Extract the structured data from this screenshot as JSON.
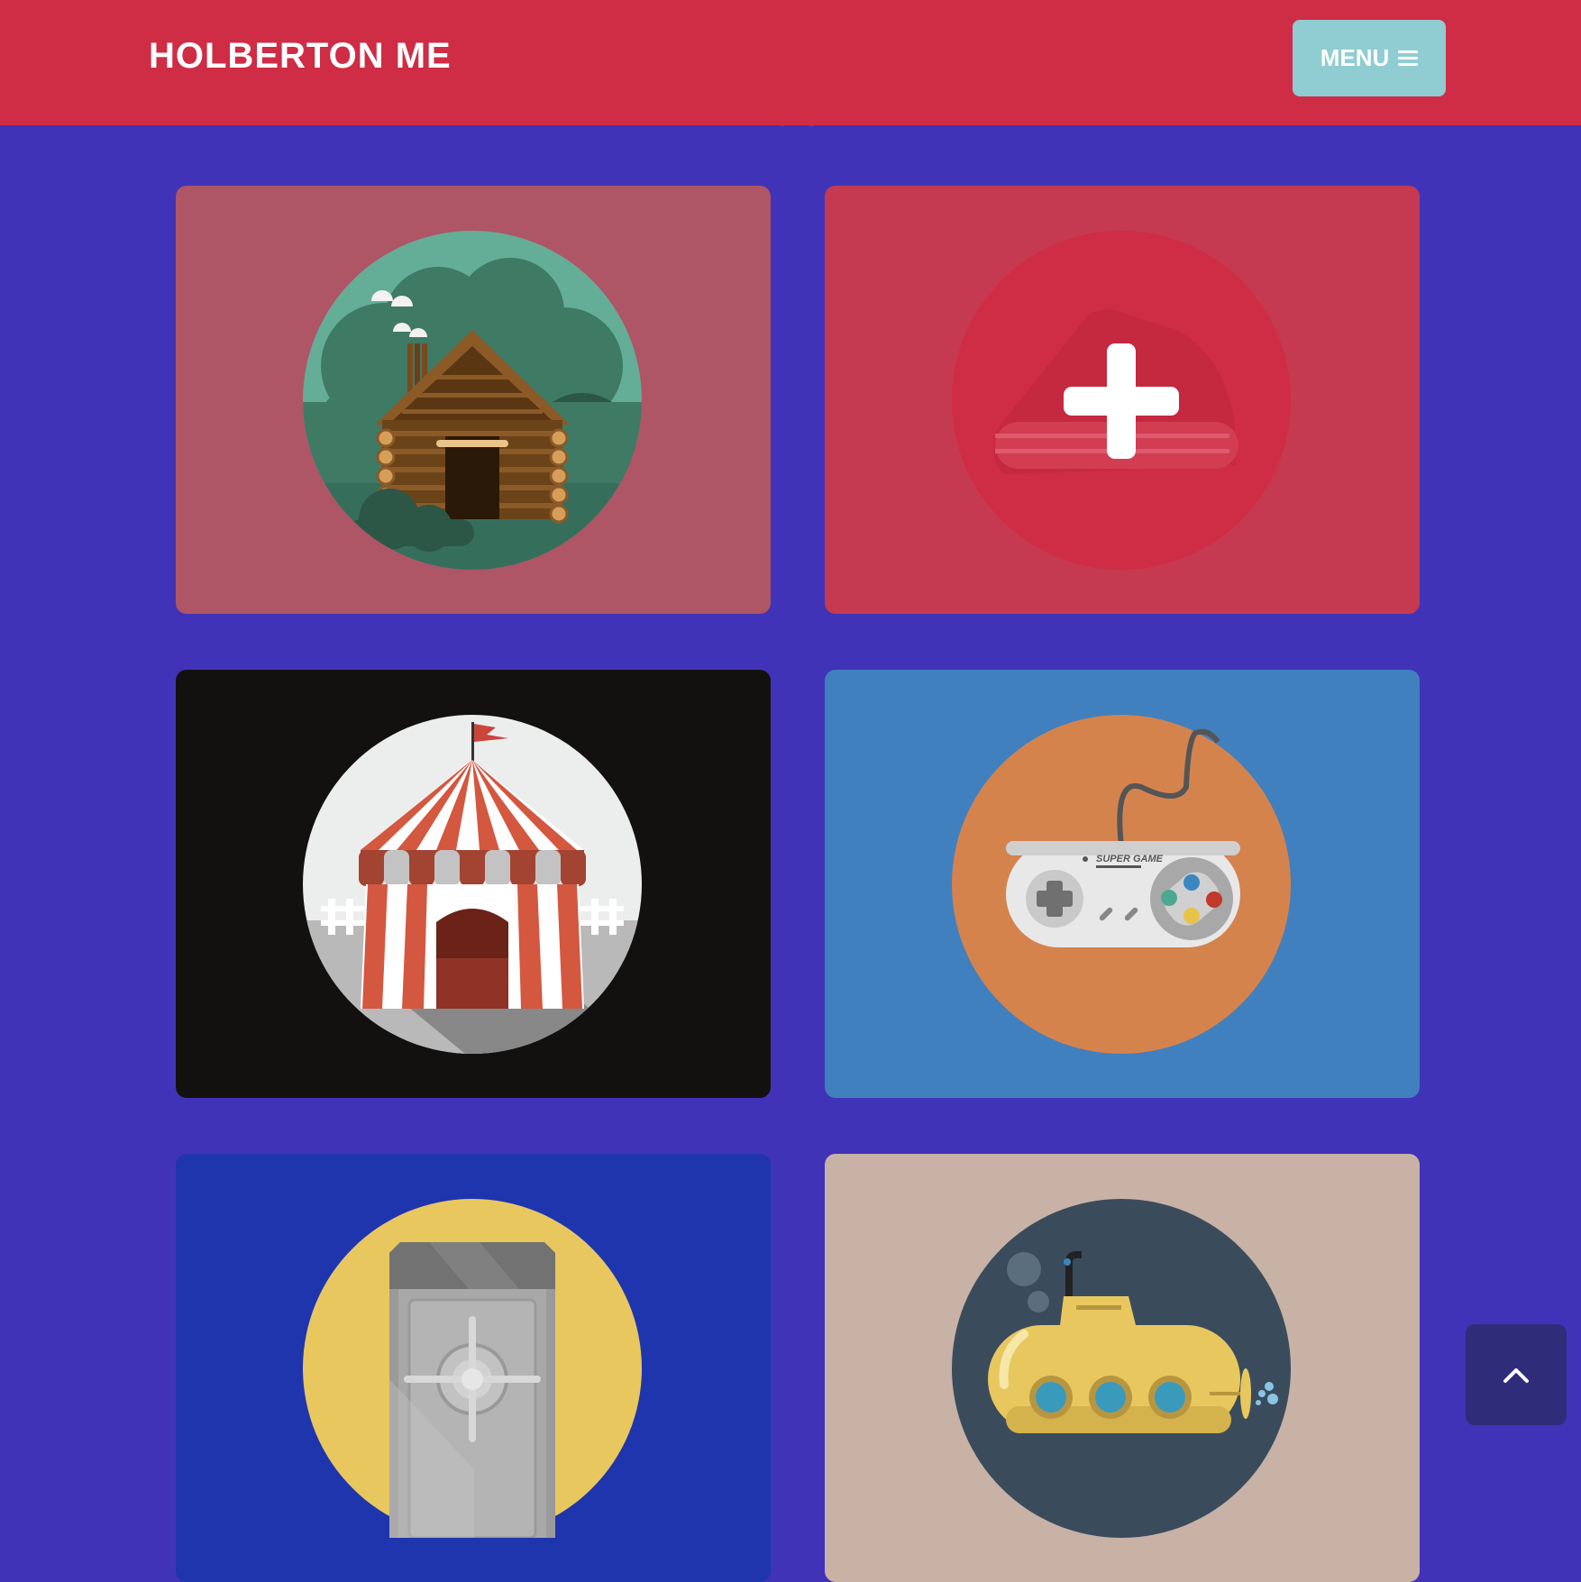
{
  "header": {
    "brand": "HOLBERTON ME",
    "menu_label": "MENU",
    "menu_icon": "hamburger-icon",
    "background": "#cf2c45",
    "menu_background": "#8fcdd2"
  },
  "page": {
    "background": "#4133b7"
  },
  "portfolio": {
    "items": [
      {
        "icon": "log-cabin-icon",
        "background": "#ae5566"
      },
      {
        "icon": "plus-icon",
        "background": "#c53a51"
      },
      {
        "icon": "circus-tent-icon",
        "background": "#121110"
      },
      {
        "icon": "game-controller-icon",
        "background": "#4080be",
        "controller_text": "SUPER GAME"
      },
      {
        "icon": "safe-icon",
        "background": "#1e35ae"
      },
      {
        "icon": "submarine-icon",
        "background": "#c8b2a5"
      }
    ]
  },
  "scroll_top": {
    "icon": "chevron-up-icon",
    "background": "#2f2d7a"
  }
}
